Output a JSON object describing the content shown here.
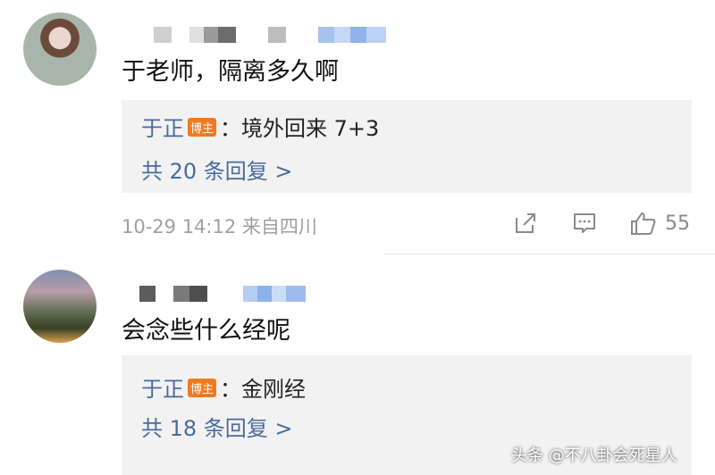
{
  "comments": [
    {
      "text": "于老师，隔离多久啊",
      "reply": {
        "author": "于正",
        "badge": "博主",
        "content": "：境外回来 7+3",
        "count_label": "共 20 条回复 >"
      },
      "meta": "10-29 14:12  来自四川",
      "likes": "55"
    },
    {
      "text": "会念些什么经呢",
      "reply": {
        "author": "于正",
        "badge": "博主",
        "content": "：金刚经",
        "count_label": "共 18 条回复 >"
      }
    }
  ],
  "icons": [
    "share-icon",
    "comment-icon",
    "like-icon"
  ],
  "watermark": "头条 @不八卦会死星人",
  "colors": {
    "link": "#4a6b9d",
    "badge": "#f17a21",
    "reply_bg": "#f2f2f2",
    "meta": "#a0a0a0"
  }
}
